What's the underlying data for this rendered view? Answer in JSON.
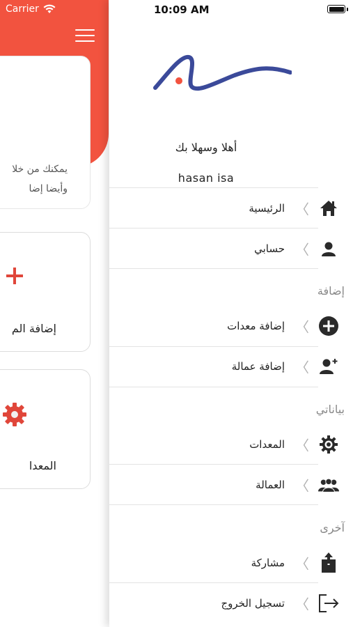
{
  "status_bar": {
    "carrier": "Carrier",
    "time": "10:09 AM"
  },
  "background_page": {
    "intro_line_1": "يمكنك من خلا",
    "intro_line_2": "وأيضا إضا",
    "tile_add_label": "إضافة الم",
    "tile_equipment_label": "المعدا",
    "accent_color": "#f2533f"
  },
  "drawer": {
    "greeting": "أهلا وسهلا بك",
    "username": "hasan isa",
    "items": [
      {
        "label": "الرئيسية",
        "icon": "home-icon"
      },
      {
        "label": "حسابي",
        "icon": "user-icon"
      },
      {
        "label": "إضافة معدات",
        "icon": "plus-circle-icon"
      },
      {
        "label": "إضافة عمالة",
        "icon": "add-user-icon"
      },
      {
        "label": "المعدات",
        "icon": "gear-icon"
      },
      {
        "label": "العمالة",
        "icon": "group-icon"
      },
      {
        "label": "مشاركة",
        "icon": "share-icon"
      },
      {
        "label": "تسجيل الخروج",
        "icon": "logout-icon"
      }
    ],
    "sections": {
      "add": "إضافة",
      "my_data": "بياناتي",
      "other": "آخرى"
    },
    "chevron": "〈"
  }
}
